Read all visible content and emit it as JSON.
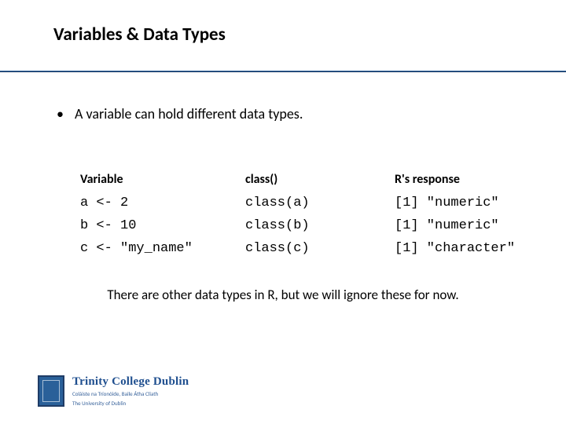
{
  "title": "Variables & Data Types",
  "bullet": "A variable can hold different data types.",
  "table": {
    "headers": {
      "var": "Variable",
      "call": "class()",
      "resp": "R's response"
    },
    "rows": [
      {
        "var": "a <- 2",
        "call": "class(a)",
        "resp": "[1] \"numeric\""
      },
      {
        "var": "b <- 10",
        "call": "class(b)",
        "resp": "[1] \"numeric\""
      },
      {
        "var": "c <- \"my_name\"",
        "call": "class(c)",
        "resp": "[1] \"character\""
      }
    ]
  },
  "closing": "There are other data types in R, but we will ignore these for now.",
  "footer": {
    "name": "Trinity College Dublin",
    "sub1": "Coláiste na Tríonóide, Baile Átha Cliath",
    "sub2": "The University of Dublin"
  }
}
